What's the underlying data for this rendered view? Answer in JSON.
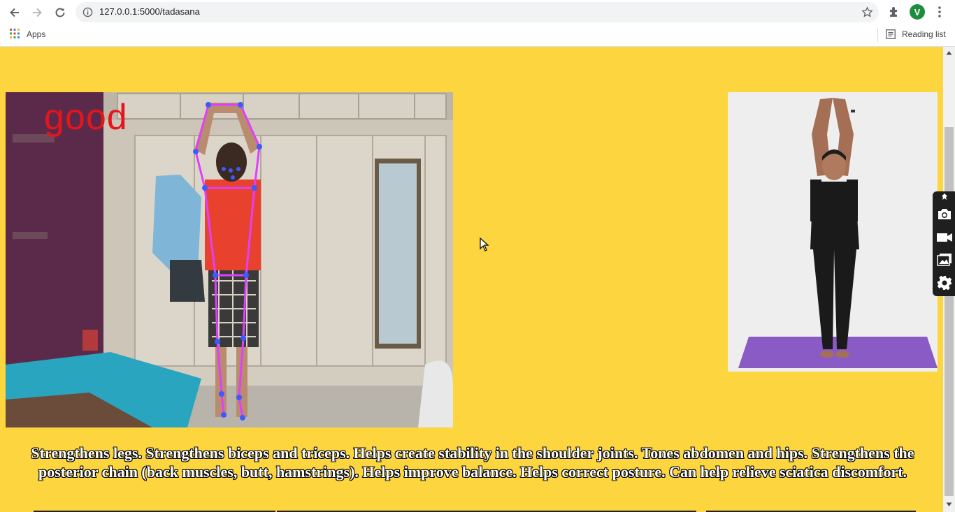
{
  "browser": {
    "url": "127.0.0.1:5000/tadasana",
    "profile_initial": "V",
    "bookmarks": {
      "apps_label": "Apps",
      "reading_list_label": "Reading list"
    }
  },
  "page": {
    "background_color": "#fcd53f",
    "camera_feed": {
      "status_label": "good",
      "status_color": "#e4151b",
      "skeleton_color": "#e040fb",
      "joint_color": "#3d5afe"
    },
    "reference_image_alt": "Tadasana reference pose",
    "benefits_text": "Strengthens legs. Strengthens biceps and triceps. Helps create stability in the shoulder joints. Tones abdomen and hips. Strengthens the posterior chain (back muscles, butt, hamstrings). Helps improve balance. Helps correct posture. Can help relieve sciatica discomfort."
  },
  "icons": {
    "back": "arrow-left-icon",
    "forward": "arrow-right-icon",
    "reload": "reload-icon",
    "site_info": "info-icon",
    "bookmark": "star-icon",
    "extensions": "puzzle-icon",
    "menu": "kebab-menu-icon",
    "apps": "apps-grid-icon",
    "reading_list": "reading-list-icon",
    "capture_tools": [
      "pin-icon",
      "camera-icon",
      "video-icon",
      "gallery-icon",
      "gear-icon"
    ]
  }
}
